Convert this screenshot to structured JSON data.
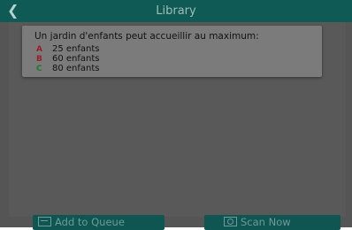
{
  "header": {
    "back_icon": "chevron-left-icon",
    "title": "Library",
    "background": "#0f5a55"
  },
  "card": {
    "question": "Un jardin d'enfants peut accueillir au maximum:",
    "options": [
      {
        "letter": "A",
        "text": "25 enfants",
        "color": "#9b1d24"
      },
      {
        "letter": "B",
        "text": "60 enfants",
        "color": "#9b1d24"
      },
      {
        "letter": "C",
        "text": "80 enfants",
        "color": "#1d7a2c"
      }
    ]
  },
  "footer": {
    "add_to_queue_label": "Add to Queue",
    "add_to_queue_icon": "queue-icon",
    "scan_now_label": "Scan Now",
    "scan_now_icon": "camera-icon"
  }
}
